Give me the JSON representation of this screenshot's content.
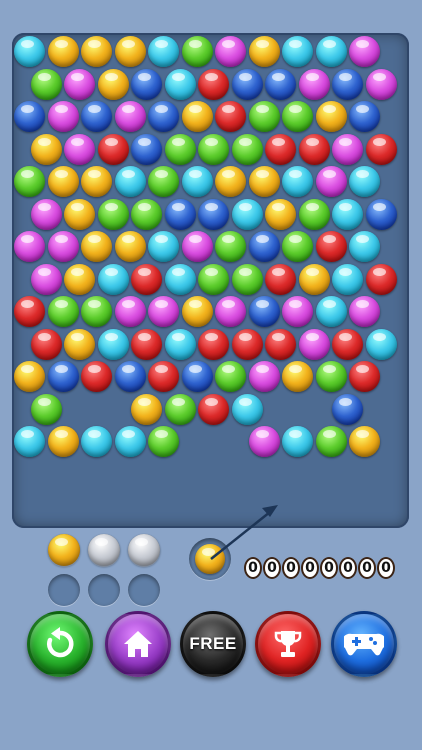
{
  "colors": {
    "cyan": "#3ec9ea",
    "yellow": "#f2b21c",
    "green": "#5ccc2c",
    "magenta": "#d94ee0",
    "blue": "#2f63cf",
    "red": "#dc2a2a",
    "silver": "#c8ccd4",
    "board": "#4d6b92",
    "background": "#8aa4c8"
  },
  "board": {
    "rows": [
      [
        "cyan",
        "yellow",
        "yellow",
        "yellow",
        "cyan",
        "green",
        "magenta",
        "yellow",
        "cyan",
        "cyan",
        "magenta"
      ],
      [
        "green",
        "magenta",
        "yellow",
        "blue",
        "cyan",
        "red",
        "blue",
        "blue",
        "magenta",
        "blue",
        "magenta"
      ],
      [
        "blue",
        "magenta",
        "blue",
        "magenta",
        "blue",
        "yellow",
        "red",
        "green",
        "green",
        "yellow",
        "blue"
      ],
      [
        "yellow",
        "magenta",
        "red",
        "blue",
        "green",
        "green",
        "green",
        "red",
        "red",
        "magenta",
        "red"
      ],
      [
        "green",
        "yellow",
        "yellow",
        "cyan",
        "green",
        "cyan",
        "yellow",
        "yellow",
        "cyan",
        "magenta",
        "cyan"
      ],
      [
        "magenta",
        "yellow",
        "green",
        "green",
        "blue",
        "blue",
        "cyan",
        "yellow",
        "green",
        "cyan",
        "blue"
      ],
      [
        "magenta",
        "magenta",
        "yellow",
        "yellow",
        "cyan",
        "magenta",
        "green",
        "blue",
        "green",
        "red",
        "cyan"
      ],
      [
        "magenta",
        "yellow",
        "cyan",
        "red",
        "cyan",
        "green",
        "green",
        "red",
        "yellow",
        "cyan",
        "red"
      ],
      [
        "red",
        "green",
        "green",
        "magenta",
        "magenta",
        "yellow",
        "magenta",
        "blue",
        "magenta",
        "cyan",
        "magenta"
      ],
      [
        "red",
        "yellow",
        "cyan",
        "red",
        "cyan",
        "red",
        "red",
        "red",
        "magenta",
        "red",
        "cyan"
      ],
      [
        "yellow",
        "blue",
        "red",
        "blue",
        "red",
        "blue",
        "green",
        "magenta",
        "yellow",
        "green",
        "red"
      ],
      [
        "green",
        null,
        null,
        "yellow",
        "green",
        "red",
        "cyan",
        null,
        null,
        "blue",
        null
      ],
      [
        "cyan",
        "yellow",
        "cyan",
        "cyan",
        "green",
        null,
        null,
        "magenta",
        "cyan",
        "green",
        "yellow"
      ]
    ]
  },
  "queue": [
    "yellow",
    "silver",
    "silver"
  ],
  "current_bubble": "yellow",
  "score": {
    "digits": [
      "0",
      "0",
      "0",
      "0",
      "0",
      "0",
      "0",
      "0"
    ]
  },
  "buttons": [
    {
      "id": "restart",
      "icon": "restart-icon",
      "color": "#2bb52f",
      "label": ""
    },
    {
      "id": "home",
      "icon": "home-icon",
      "color": "#9a3fc9",
      "label": ""
    },
    {
      "id": "free",
      "icon": "",
      "color": "#2a2a2a",
      "label": "FREE"
    },
    {
      "id": "trophy",
      "icon": "trophy-icon",
      "color": "#e02424",
      "label": ""
    },
    {
      "id": "games",
      "icon": "gamepad-icon",
      "color": "#1f6fe0",
      "label": ""
    }
  ]
}
